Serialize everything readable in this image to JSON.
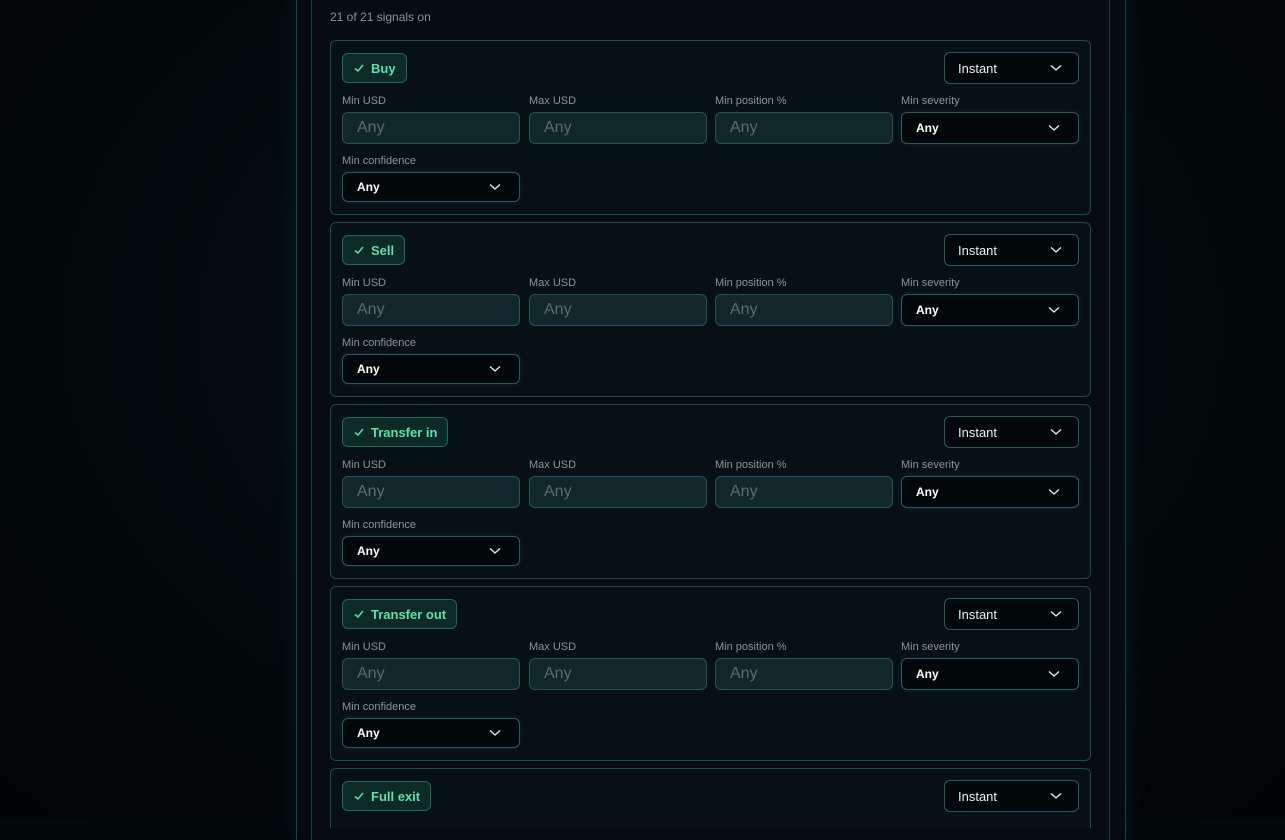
{
  "summary": "21 of 21 signals on",
  "labels": {
    "min_usd": "Min USD",
    "max_usd": "Max USD",
    "min_position": "Min position %",
    "min_severity": "Min severity",
    "min_confidence": "Min confidence"
  },
  "placeholder": "Any",
  "cards": [
    {
      "name": "Buy",
      "frequency": "Instant",
      "severity": "Any",
      "confidence": "Any"
    },
    {
      "name": "Sell",
      "frequency": "Instant",
      "severity": "Any",
      "confidence": "Any"
    },
    {
      "name": "Transfer in",
      "frequency": "Instant",
      "severity": "Any",
      "confidence": "Any"
    },
    {
      "name": "Transfer out",
      "frequency": "Instant",
      "severity": "Any",
      "confidence": "Any"
    },
    {
      "name": "Full exit",
      "frequency": "Instant"
    }
  ],
  "colors": {
    "accent_green": "#5ee0a8",
    "border_teal": "#1c4a52",
    "background": "#02070a"
  }
}
